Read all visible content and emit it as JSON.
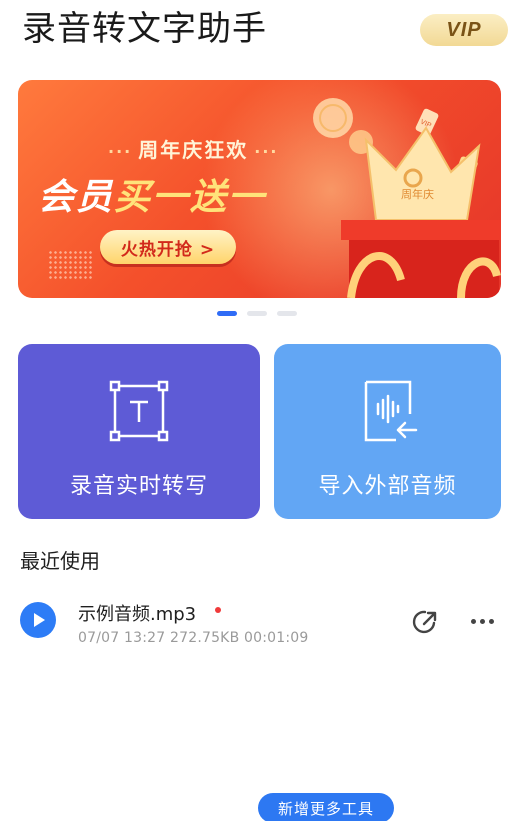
{
  "header": {
    "title": "录音转文字助手",
    "vip_label": "VIP"
  },
  "banner": {
    "subtitle": "周年庆狂欢",
    "headline_white": "会员",
    "headline_yellow": "买一送一",
    "cta_label": "火热开抢 >",
    "crown_text": "周年庆",
    "coin_text": "VIP",
    "active_slide": 1,
    "slide_count": 3
  },
  "actions": {
    "record_label": "录音实时转写",
    "import_label": "导入外部音频"
  },
  "recent": {
    "title": "最近使用",
    "files": [
      {
        "name": "示例音频.mp3",
        "date": "07/07 13:27",
        "size": "272.75KB",
        "duration": "00:01:09",
        "is_new": true
      }
    ]
  },
  "footer": {
    "add_tools_label": "新增更多工具"
  },
  "colors": {
    "accent_blue": "#2d7cf6",
    "record_card": "#5e5bd6",
    "import_card": "#62a6f4",
    "banner_red": "#f4502b",
    "new_dot": "#f03a3a"
  },
  "icons": {
    "record_card_icon": "text-frame-icon",
    "import_card_icon": "audio-import-icon",
    "play": "play-icon",
    "share": "share-arrow-icon",
    "more": "more-dots-icon"
  }
}
